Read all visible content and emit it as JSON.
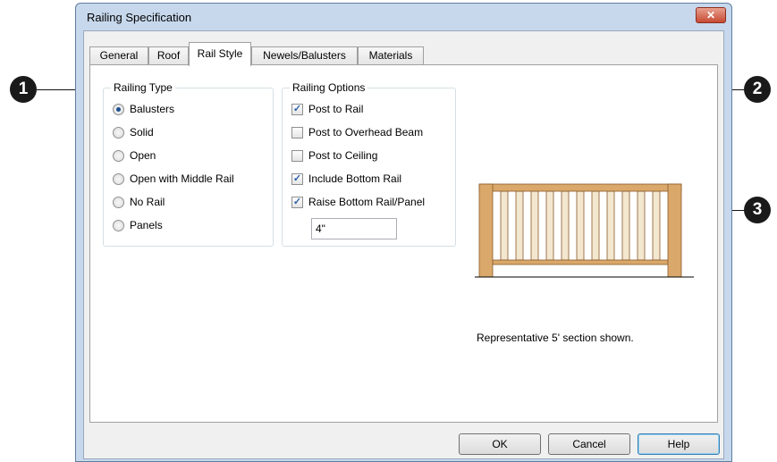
{
  "window": {
    "title": "Railing Specification",
    "close_glyph": "✕"
  },
  "tabs": [
    {
      "label": "General"
    },
    {
      "label": "Roof"
    },
    {
      "label": "Rail Style"
    },
    {
      "label": "Newels/Balusters"
    },
    {
      "label": "Materials"
    }
  ],
  "active_tab": "Rail Style",
  "railing_type": {
    "label": "Railing Type",
    "selected": "Balusters",
    "options": [
      "Balusters",
      "Solid",
      "Open",
      "Open with Middle Rail",
      "No Rail",
      "Panels"
    ]
  },
  "railing_options": {
    "label": "Railing Options",
    "items": [
      {
        "label": "Post to Rail",
        "checked": true
      },
      {
        "label": "Post to Overhead Beam",
        "checked": false
      },
      {
        "label": "Post to Ceiling",
        "checked": false
      },
      {
        "label": "Include Bottom Rail",
        "checked": true
      },
      {
        "label": "Raise Bottom Rail/Panel",
        "checked": true
      }
    ],
    "raise_value": "4\""
  },
  "preview": {
    "note": "Representative 5' section shown.",
    "colors": {
      "wood": "#d9a86a",
      "baluster": "#f3e7cf",
      "outline": "#8a5a2b"
    }
  },
  "buttons": {
    "ok": "OK",
    "cancel": "Cancel",
    "help": "Help"
  },
  "callouts": [
    "1",
    "2",
    "3"
  ]
}
